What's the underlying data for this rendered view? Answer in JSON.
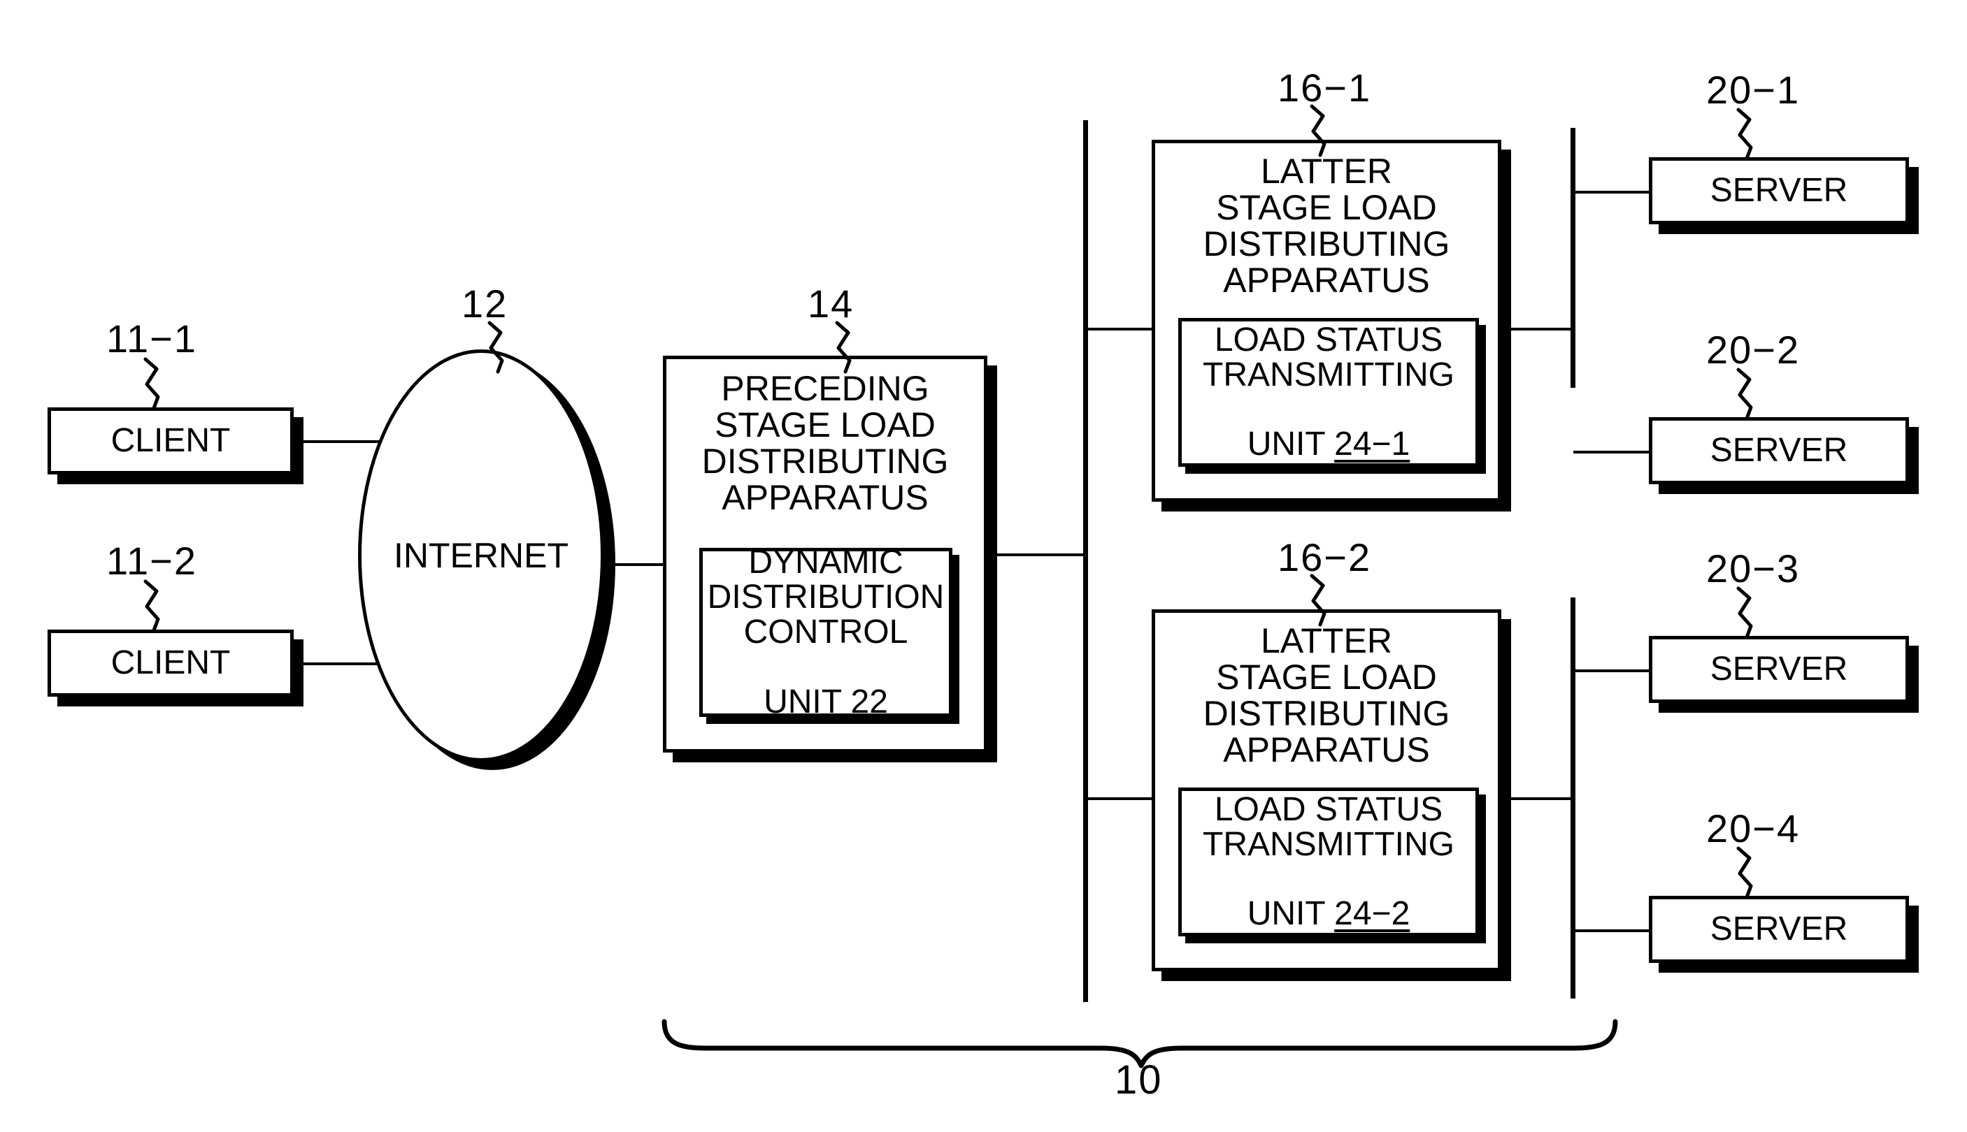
{
  "figure": {
    "title": "Load distributing system block diagram",
    "system_ref": "10"
  },
  "clients": [
    {
      "label": "CLIENT",
      "ref": "11−1"
    },
    {
      "label": "CLIENT",
      "ref": "11−2"
    }
  ],
  "network": {
    "label": "INTERNET",
    "ref": "12"
  },
  "preceding_stage": {
    "label": "PRECEDING\nSTAGE LOAD\nDISTRIBUTING\nAPPARATUS",
    "ref": "14",
    "unit": {
      "label": "DYNAMIC\nDISTRIBUTION\nCONTROL",
      "last_line_prefix": "UNIT ",
      "number": "22"
    }
  },
  "latter_stages": [
    {
      "label": "LATTER\nSTAGE LOAD\nDISTRIBUTING\nAPPARATUS",
      "ref": "16−1",
      "unit": {
        "label": "LOAD STATUS\nTRANSMITTING",
        "last_line_prefix": "UNIT ",
        "number": "24−1"
      }
    },
    {
      "label": "LATTER\nSTAGE LOAD\nDISTRIBUTING\nAPPARATUS",
      "ref": "16−2",
      "unit": {
        "label": "LOAD STATUS\nTRANSMITTING",
        "last_line_prefix": "UNIT ",
        "number": "24−2"
      }
    }
  ],
  "servers": [
    {
      "label": "SERVER",
      "ref": "20−1"
    },
    {
      "label": "SERVER",
      "ref": "20−2"
    },
    {
      "label": "SERVER",
      "ref": "20−3"
    },
    {
      "label": "SERVER",
      "ref": "20−4"
    }
  ],
  "colors": {
    "ink": "#000000",
    "paper": "#ffffff"
  }
}
